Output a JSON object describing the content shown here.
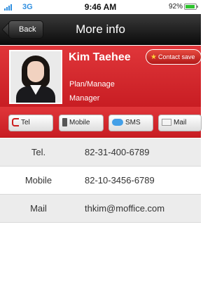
{
  "status_bar": {
    "network": "3G",
    "time": "9:46 AM",
    "battery_percent": "92%",
    "battery_level": 0.92,
    "signal_icon": "signal-bars-icon",
    "battery_icon": "battery-icon"
  },
  "nav": {
    "back_label": "Back",
    "title": "More info"
  },
  "profile": {
    "name": "Kim Taehee",
    "department": "Plan/Manage",
    "position": "Manager",
    "contact_save_label": "Contact save",
    "photo_icon": "profile-photo"
  },
  "actions": [
    {
      "label": "Tel",
      "icon": "phone-icon"
    },
    {
      "label": "Mobile",
      "icon": "mobile-icon"
    },
    {
      "label": "SMS",
      "icon": "sms-icon"
    },
    {
      "label": "Mail",
      "icon": "mail-icon"
    }
  ],
  "info": [
    {
      "label": "Tel.",
      "value": "82-31-400-6789"
    },
    {
      "label": "Mobile",
      "value": "82-10-3456-6789"
    },
    {
      "label": "Mail",
      "value": "thkim@moffice.com"
    }
  ],
  "colors": {
    "accent_red": "#d2272c",
    "nav_black": "#1a1a1a",
    "row_alt": "#ececec"
  }
}
